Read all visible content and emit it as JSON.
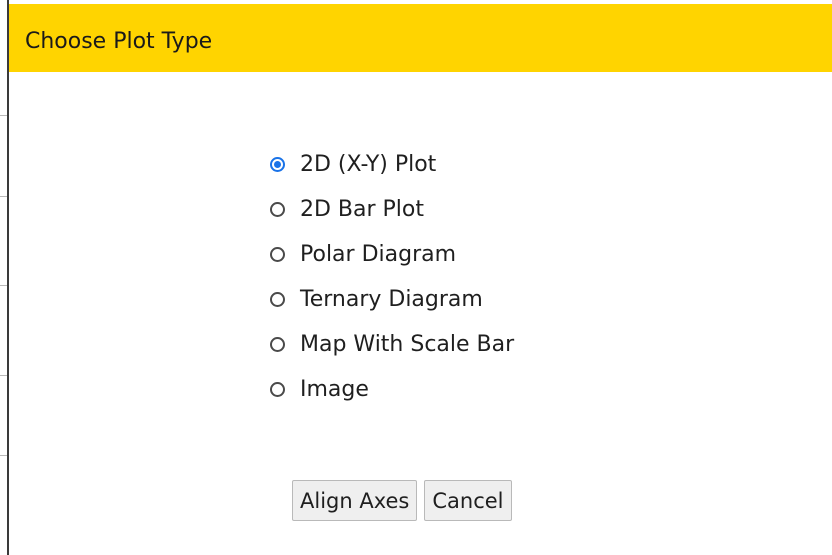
{
  "dialog": {
    "title": "Choose Plot Type",
    "header_color": "#ffd400"
  },
  "options": [
    {
      "label": "2D (X-Y) Plot",
      "selected": true
    },
    {
      "label": "2D Bar Plot",
      "selected": false
    },
    {
      "label": "Polar Diagram",
      "selected": false
    },
    {
      "label": "Ternary Diagram",
      "selected": false
    },
    {
      "label": "Map With Scale Bar",
      "selected": false
    },
    {
      "label": "Image",
      "selected": false
    }
  ],
  "buttons": {
    "align_axes_label": "Align Axes",
    "cancel_label": "Cancel"
  }
}
